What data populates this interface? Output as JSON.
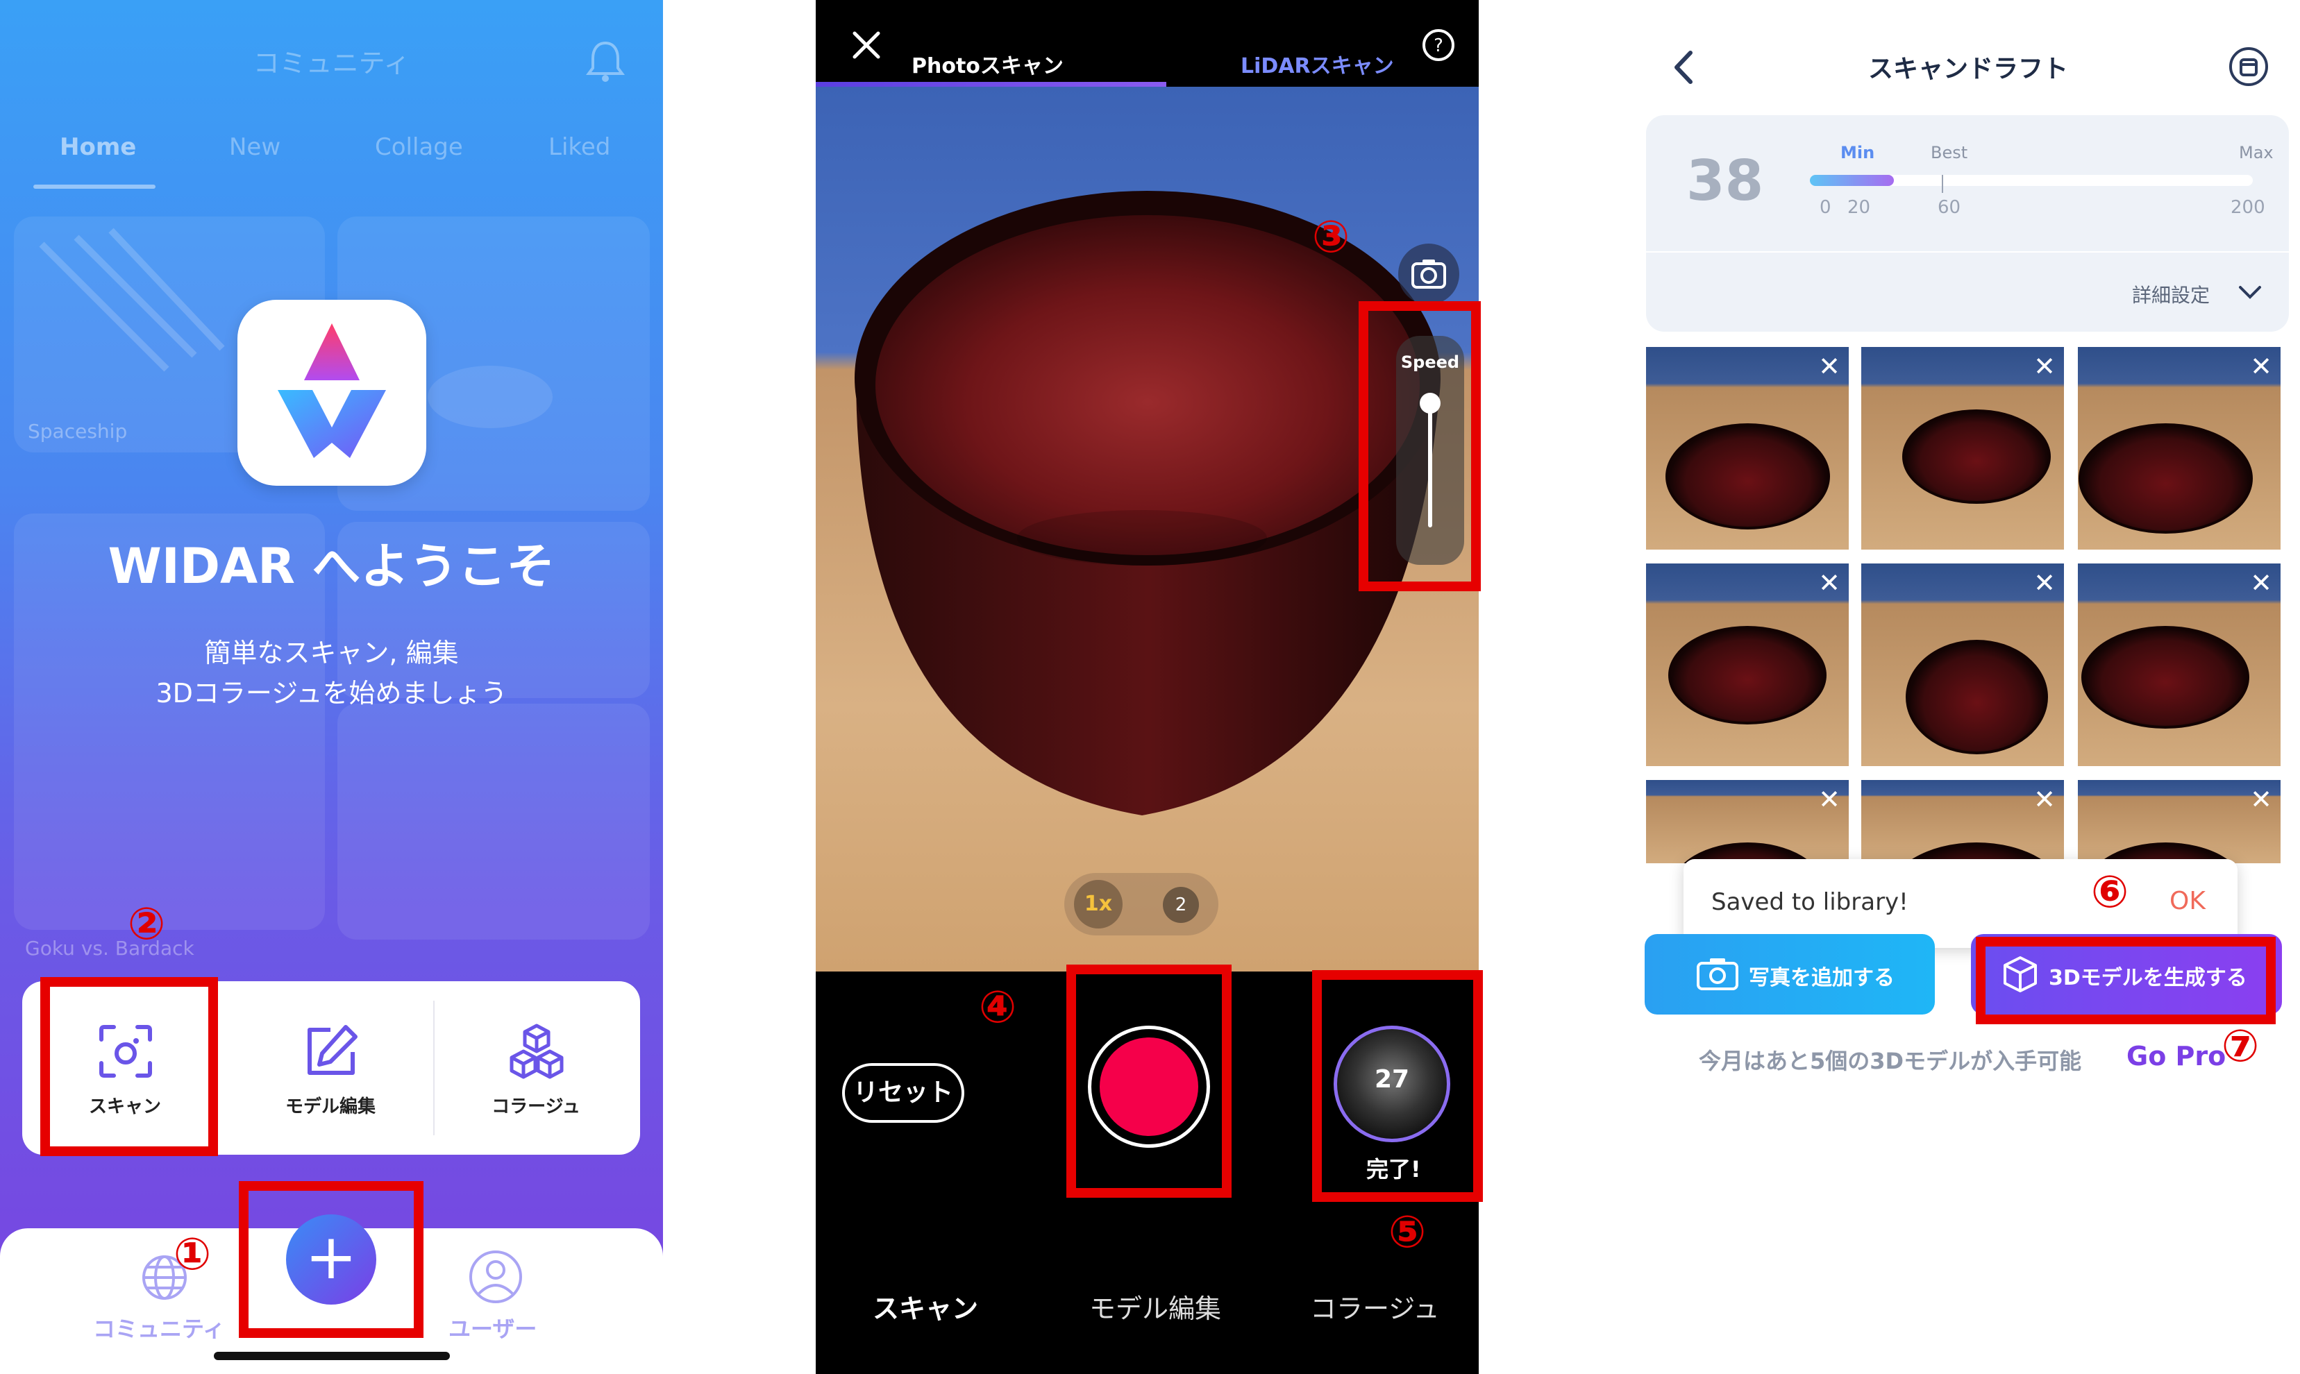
{
  "screen1": {
    "header_title": "コミュニティ",
    "tabs": [
      "Home",
      "New",
      "Collage",
      "Liked"
    ],
    "card_labels": [
      "Spaceship",
      "Goku vs. Bardack"
    ],
    "welcome_title": "WIDAR へようこそ",
    "subtitle_line1": "簡単なスキャン, 編集",
    "subtitle_line2": "3Dコラージュを始めましょう",
    "menu": [
      {
        "label": "スキャン",
        "icon": "scan-icon"
      },
      {
        "label": "モデル編集",
        "icon": "edit-icon"
      },
      {
        "label": "コラージュ",
        "icon": "cubes-icon"
      }
    ],
    "nav": {
      "community": "コミュニティ",
      "plus": "+",
      "user": "ユーザー"
    }
  },
  "screen2": {
    "close_icon": "×",
    "mode_photo": "Photoスキャン",
    "mode_lidar": "LiDARスキャン",
    "help": "?",
    "speed_label": "Speed",
    "zoom_1x": "1x",
    "zoom_2": "2",
    "reset_label": "リセット",
    "photo_count": "27",
    "done_label": "完了!",
    "bottom_tabs": [
      "スキャン",
      "モデル編集",
      "コラージュ"
    ]
  },
  "screen3": {
    "title": "スキャンドラフト",
    "photo_quality_value": "38",
    "scale_labels": {
      "min": "Min",
      "best": "Best",
      "max": "Max"
    },
    "scale_ticks": [
      "0",
      "20",
      "60",
      "200"
    ],
    "fill_fraction": 0.19,
    "detail_settings": "詳細設定",
    "toast_text": "Saved to library!",
    "toast_ok": "OK",
    "add_photo": "写真を追加する",
    "generate": "3Dモデルを生成する",
    "quota_text": "今月はあと5個の3Dモデルが入手可能",
    "go_pro": "Go Pro"
  },
  "annotations": [
    "①",
    "②",
    "③",
    "④",
    "⑤",
    "⑥",
    "⑦"
  ],
  "colors": {
    "annotation_red": "#e60000",
    "record_red": "#f5004a",
    "accent_purple": "#7b3fe6",
    "accent_blue": "#1fb0f5"
  }
}
